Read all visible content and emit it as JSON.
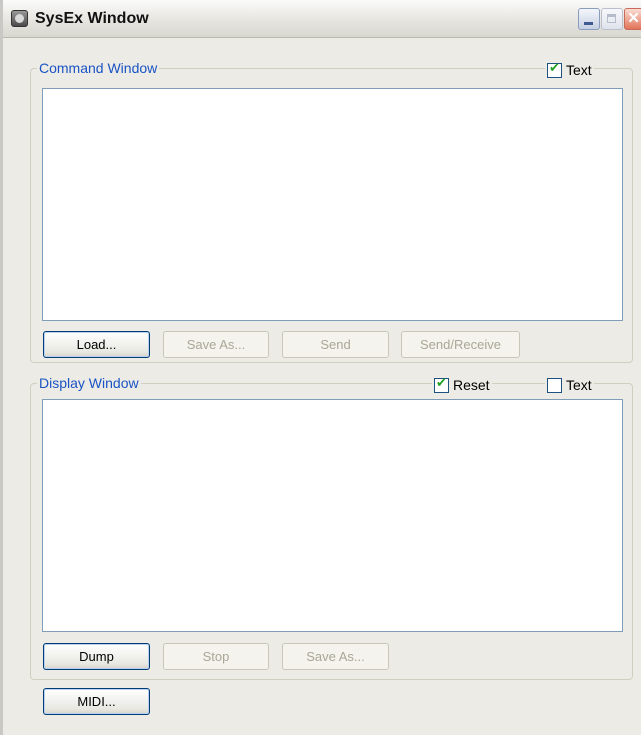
{
  "window": {
    "title": "SysEx Window"
  },
  "command_window": {
    "legend": "Command Window",
    "text_checkbox": {
      "label": "Text",
      "checked": true
    },
    "buttons": {
      "load": "Load...",
      "save_as": "Save As...",
      "send": "Send",
      "send_receive": "Send/Receive"
    }
  },
  "display_window": {
    "legend": "Display Window",
    "reset_checkbox": {
      "label": "Reset",
      "checked": true
    },
    "text_checkbox": {
      "label": "Text",
      "checked": false
    },
    "buttons": {
      "dump": "Dump",
      "stop": "Stop",
      "save_as": "Save As..."
    }
  },
  "midi_button": "MIDI..."
}
